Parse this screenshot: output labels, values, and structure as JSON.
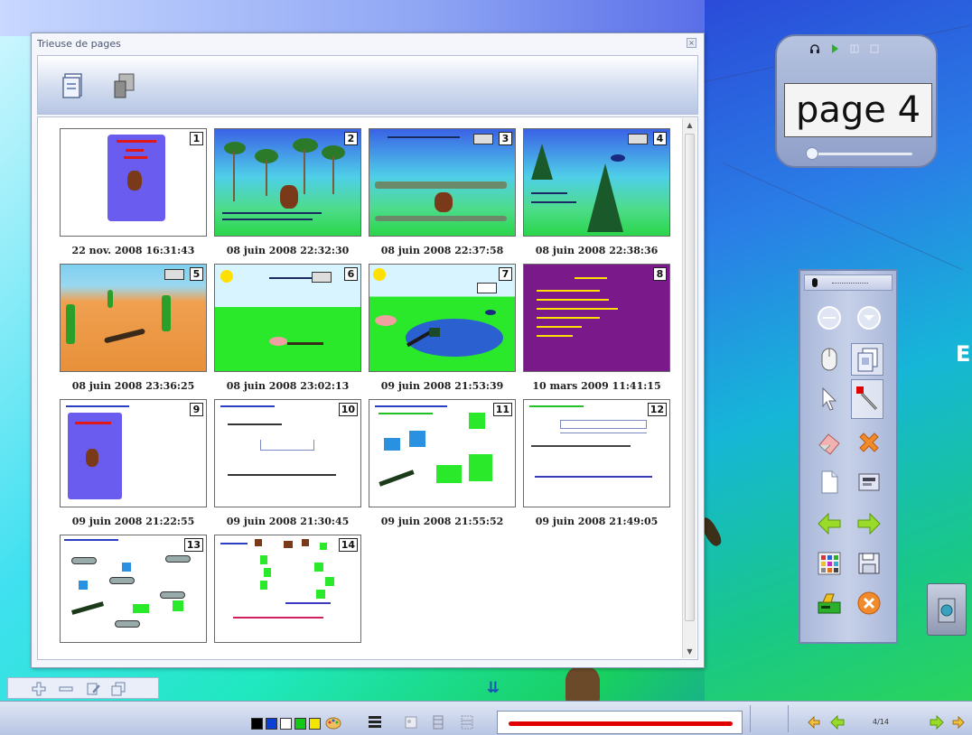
{
  "sorter": {
    "title": "Trieuse de pages",
    "close_label": "×"
  },
  "pages": [
    {
      "num": "1",
      "date": "22 nov. 2008 16:31:43"
    },
    {
      "num": "2",
      "date": "08 juin 2008 22:32:30"
    },
    {
      "num": "3",
      "date": "08 juin 2008 22:37:58"
    },
    {
      "num": "4",
      "date": "08 juin 2008 22:38:36"
    },
    {
      "num": "5",
      "date": "08 juin 2008 23:36:25"
    },
    {
      "num": "6",
      "date": "08 juin 2008 23:02:13"
    },
    {
      "num": "7",
      "date": "09 juin 2008 21:53:39"
    },
    {
      "num": "8",
      "date": "10 mars 2009 11:41:15"
    },
    {
      "num": "9",
      "date": "09 juin 2008 21:22:55"
    },
    {
      "num": "10",
      "date": "09 juin 2008 21:30:45"
    },
    {
      "num": "11",
      "date": "09 juin 2008 21:55:52"
    },
    {
      "num": "12",
      "date": "09 juin 2008 21:49:05"
    },
    {
      "num": "13",
      "date": ""
    },
    {
      "num": "14",
      "date": ""
    }
  ],
  "page_indicator": {
    "text": "page 4"
  },
  "taskbar": {
    "swatches": [
      "#000000",
      "#0b3fd6",
      "#ffffff",
      "#16c816",
      "#f2e600"
    ],
    "page_count": "4/14",
    "stroke_color": "#e00000"
  },
  "colors": {
    "accent": "#1a4fb8",
    "window_bg": "#f4f6fb"
  }
}
